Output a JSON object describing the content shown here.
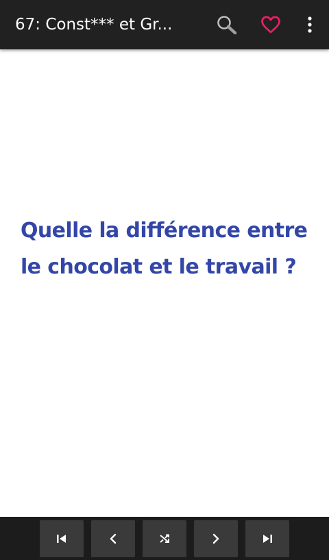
{
  "app_bar": {
    "title": "67: Const*** et Gr...",
    "actions": [
      {
        "name": "search",
        "icon": "search-icon"
      },
      {
        "name": "favorite",
        "icon": "heart-outline-icon",
        "color": "#e91e63"
      },
      {
        "name": "more",
        "icon": "more-vert-icon"
      }
    ]
  },
  "content": {
    "joke_text": "Quelle la différence entre le chocolat et le travail ?",
    "text_color": "#3346a8"
  },
  "bottom_nav": {
    "buttons": [
      {
        "name": "first",
        "icon": "skip-previous-icon"
      },
      {
        "name": "previous",
        "icon": "chevron-left-icon"
      },
      {
        "name": "random",
        "icon": "shuffle-icon"
      },
      {
        "name": "next",
        "icon": "chevron-right-icon"
      },
      {
        "name": "last",
        "icon": "skip-next-icon"
      }
    ]
  },
  "colors": {
    "app_bar": "#212121",
    "bottom_bar": "#1c1c1c",
    "button": "#3a3a3a",
    "accent": "#e91e63"
  }
}
